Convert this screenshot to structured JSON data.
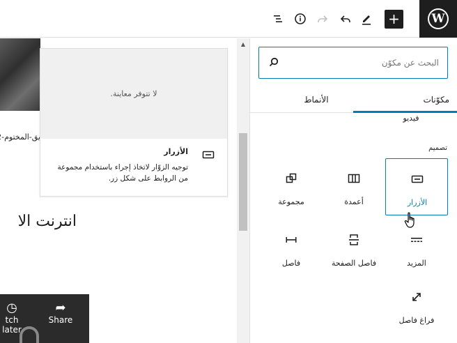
{
  "toolbar": {
    "add_label": "+",
    "logo_letter": "W"
  },
  "canvas": {
    "photo_caption": "يق-المختوم-2",
    "heading": "انترنت الا",
    "video": {
      "watch_later": "tch later",
      "share": "Share"
    }
  },
  "preview": {
    "no_preview": "لا تتوفر معاينة.",
    "title": "الأزرار",
    "description": "توجيه الزوّار لاتخاذ إجراء باستخدام مجموعة من الروابط على شكل زر."
  },
  "inserter": {
    "search": {
      "placeholder": "البحث عن مكوّن",
      "value": ""
    },
    "tabs": [
      {
        "label": "مكوّنات",
        "active": true
      },
      {
        "label": "الأنماط",
        "active": false
      }
    ],
    "partial_previous_block": "فيديو",
    "category_title": "تصميم",
    "blocks": [
      {
        "label": "الأزرار",
        "icon": "buttons-icon",
        "selected": true
      },
      {
        "label": "أعمدة",
        "icon": "columns-icon",
        "selected": false
      },
      {
        "label": "مجموعة",
        "icon": "group-icon",
        "selected": false
      },
      {
        "label": "المزيد",
        "icon": "more-icon",
        "selected": false
      },
      {
        "label": "فاصل الصفحة",
        "icon": "page-break-icon",
        "selected": false
      },
      {
        "label": "فاصل",
        "icon": "separator-icon",
        "selected": false
      },
      {
        "label": "فراغ فاصل",
        "icon": "spacer-icon",
        "selected": false
      }
    ]
  },
  "colors": {
    "accent": "#007cba",
    "dark": "#1e1e1e",
    "preview_bg": "#f0f0f0"
  }
}
